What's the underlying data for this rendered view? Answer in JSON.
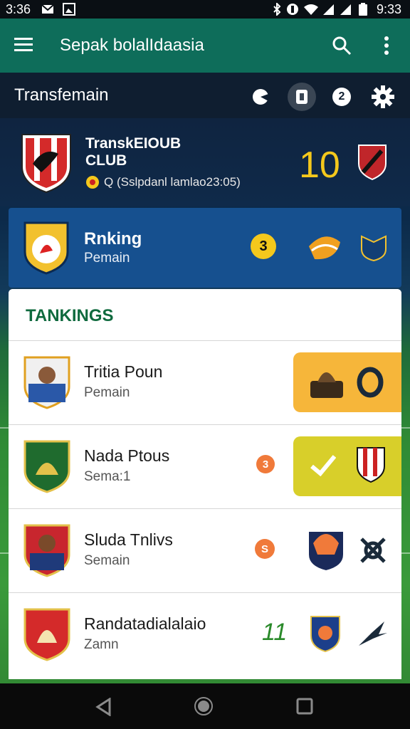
{
  "status_bar": {
    "time_left": "3:36",
    "time_right": "9:33"
  },
  "app_bar": {
    "title": "Sepak bolalIdaasia"
  },
  "sub_bar": {
    "title": "Transfemain",
    "icon4_label": "2"
  },
  "club": {
    "name_line1": "TranskEIOUB",
    "name_line2": "CLUB",
    "meta": "Q (Sslpdanl lamlao23:05)",
    "score": "10"
  },
  "ranking": {
    "title": "Rnking",
    "subtitle": "Pemain",
    "badge": "3"
  },
  "list": {
    "header": "TANKINGS",
    "rows": [
      {
        "name": "Tritia Poun",
        "sub": "Pemain",
        "badge": "",
        "tile_color": "#f6b63a"
      },
      {
        "name": "Nada Ptous",
        "sub": "Sema:1",
        "badge": "3",
        "tile_color": "#d8cf2a"
      },
      {
        "name": "Sluda Tnlivs",
        "sub": "Semain",
        "badge": "S",
        "tile_color": ""
      },
      {
        "name": "Randatadialalaio",
        "sub": "Zamn",
        "badge": "11",
        "tile_color": ""
      }
    ]
  },
  "colors": {
    "app_bar": "#0e6d5a",
    "accent_yellow": "#f4c81c",
    "ranking_card": "#16508f",
    "header_green": "#0f6a3e",
    "badge_orange": "#f07a3a"
  }
}
